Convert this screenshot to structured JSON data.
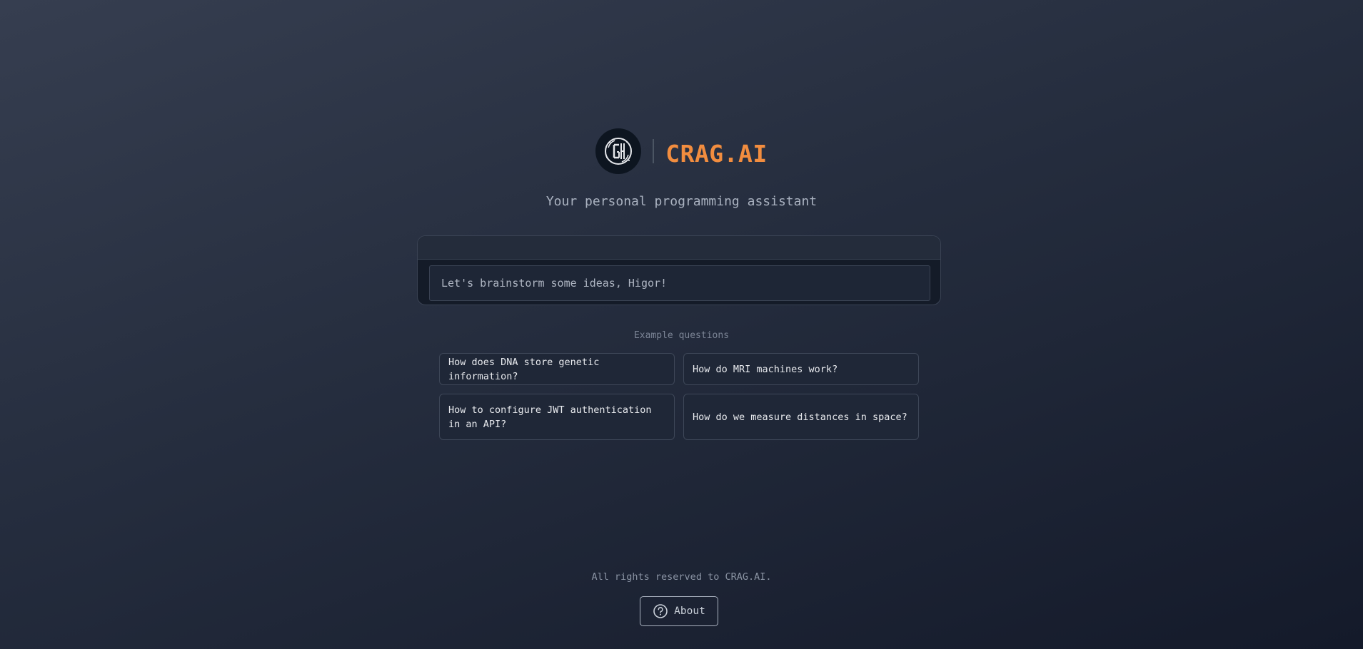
{
  "header": {
    "logo_icon": "gh-circle-logo-icon",
    "brand": "CRAG.AI",
    "brand_color": "#f28d3f"
  },
  "tagline": "Your personal programming assistant",
  "prompt": {
    "placeholder": "Let's brainstorm some ideas, Higor!",
    "value": ""
  },
  "examples": {
    "title": "Example questions",
    "items": [
      "How does DNA store genetic information?",
      "How do MRI machines work?",
      "How to configure JWT authentication in an API?",
      "How do we measure distances in space?"
    ]
  },
  "footer": {
    "text": "All rights reserved to CRAG.AI.",
    "about_label": "About",
    "about_icon": "question-circle-icon"
  }
}
